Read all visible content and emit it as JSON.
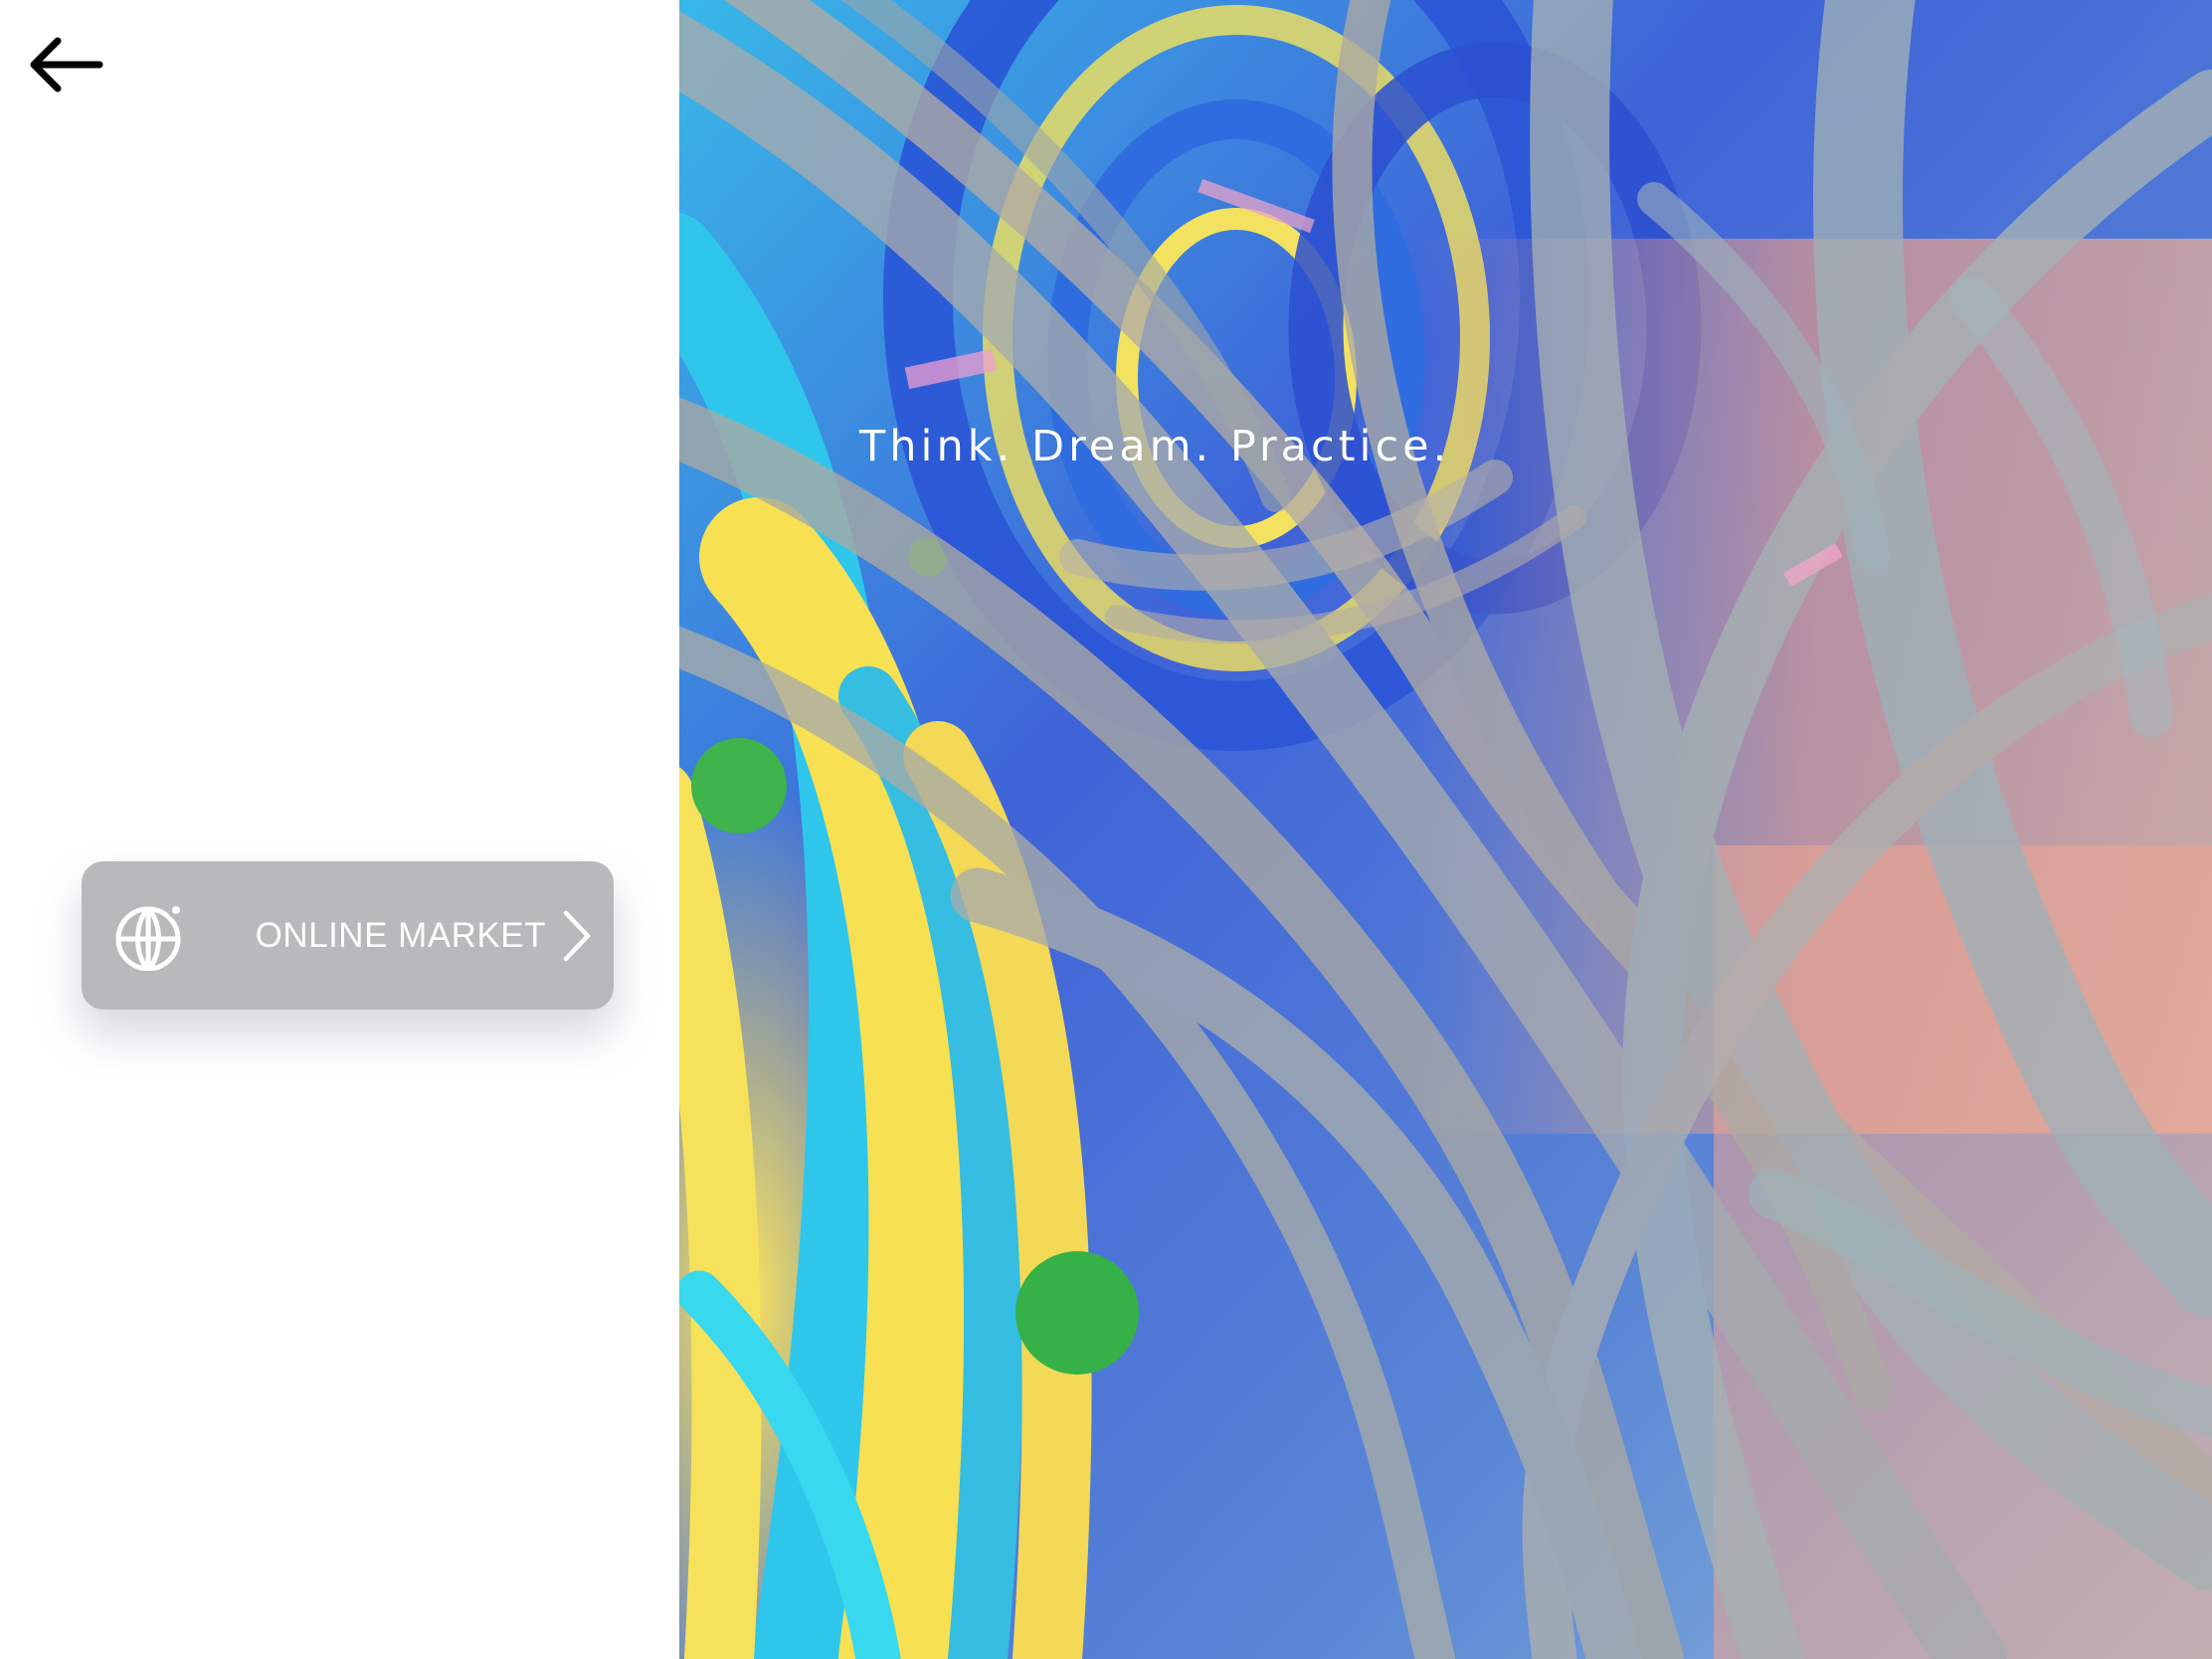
{
  "nav": {
    "back_icon": "arrow-left-icon"
  },
  "hero": {
    "tagline": "Think. Dream. Practice."
  },
  "market_button": {
    "label": "ONLINE MARKET",
    "icon": "globe-icon",
    "chevron_icon": "chevron-right-icon"
  },
  "colors": {
    "button_bg": "#b9b9bb",
    "text_light": "#ffffff",
    "icon_dark": "#000000"
  }
}
